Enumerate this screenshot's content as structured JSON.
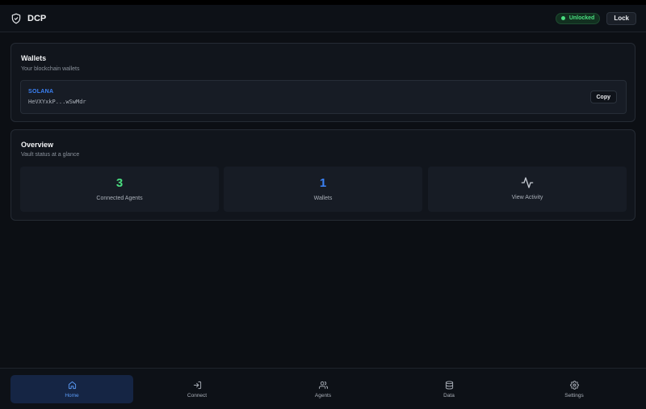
{
  "header": {
    "app_title": "DCP",
    "logo_icon": "shield-check-icon",
    "status_label": "Unlocked",
    "status_color": "#4ade80",
    "lock_label": "Lock"
  },
  "wallets": {
    "title": "Wallets",
    "subtitle": "Your blockchain wallets",
    "items": [
      {
        "chain": "SOLANA",
        "address": "HeVXYxkP...wSwMdr",
        "copy_label": "Copy"
      }
    ]
  },
  "overview": {
    "title": "Overview",
    "subtitle": "Vault status at a glance",
    "stats": [
      {
        "value": "3",
        "label": "Connected Agents",
        "color": "#4ade80"
      },
      {
        "value": "1",
        "label": "Wallets",
        "color": "#3b82f6"
      }
    ],
    "activity": {
      "label": "View Activity",
      "icon": "activity-icon"
    }
  },
  "nav": {
    "items": [
      {
        "label": "Home",
        "icon": "home-icon",
        "active": true
      },
      {
        "label": "Connect",
        "icon": "log-in-icon",
        "active": false
      },
      {
        "label": "Agents",
        "icon": "users-icon",
        "active": false
      },
      {
        "label": "Data",
        "icon": "database-icon",
        "active": false
      },
      {
        "label": "Settings",
        "icon": "gear-icon",
        "active": false
      }
    ]
  },
  "colors": {
    "accent": "#3b82f6",
    "success": "#4ade80",
    "background": "#0c0f14",
    "card": "#11151c"
  }
}
